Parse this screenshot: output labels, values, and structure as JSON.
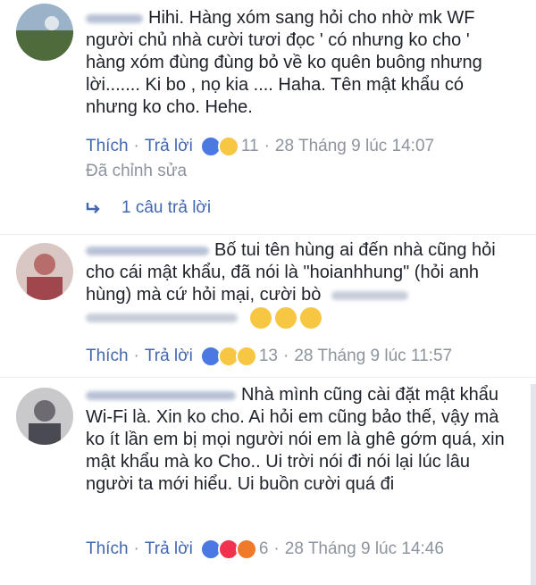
{
  "comments": [
    {
      "text": "Hihi. Hàng xóm sang hỏi cho nhờ mk WF người chủ nhà cười tươi đọc ' có nhưng ko cho ' hàng xóm đùng đùng bỏ về ko quên buông nhưng lời....... Ki bo , nọ kia .... Haha. Tên mật khẩu có nhưng ko cho. Hehe.",
      "like_label": "Thích",
      "reply_label": "Trả lời",
      "reaction_count": "11",
      "time": "28 Tháng 9 lúc 14:07",
      "edited": "Đã chỉnh sửa",
      "replies": "1 câu trả lời",
      "reactions": [
        "like-icon",
        "haha-icon"
      ]
    },
    {
      "text": "Bố tui tên hùng ai đến nhà cũng hỏi cho cái mật khẩu, đã nói là \"hoianhhung\" (hỏi anh hùng) mà cứ hỏi mại, cười bò",
      "like_label": "Thích",
      "reply_label": "Trả lời",
      "reaction_count": "13",
      "time": "28 Tháng 9 lúc 11:57",
      "reactions": [
        "like-icon",
        "haha-icon",
        "wow-icon"
      ]
    },
    {
      "text": "Nhà mình cũng cài đặt mật khẩu Wi-Fi là. Xin ko cho. Ai hỏi em cũng bảo thế, vậy mà ko ít lần em bị mọi người nói em là ghê gớm quá, xin mật khẩu mà ko Cho.. Ui trời nói đi nói lại lúc lâu người ta mới hiểu. Ui buồn cười quá đi",
      "like_label": "Thích",
      "reply_label": "Trả lời",
      "reaction_count": "6",
      "time": "28 Tháng 9 lúc 14:46",
      "reactions": [
        "like-icon",
        "love-icon",
        "angry-icon"
      ]
    }
  ],
  "colors": {
    "link": "#4267b2",
    "meta": "#8d949e",
    "text": "#1d2129"
  }
}
